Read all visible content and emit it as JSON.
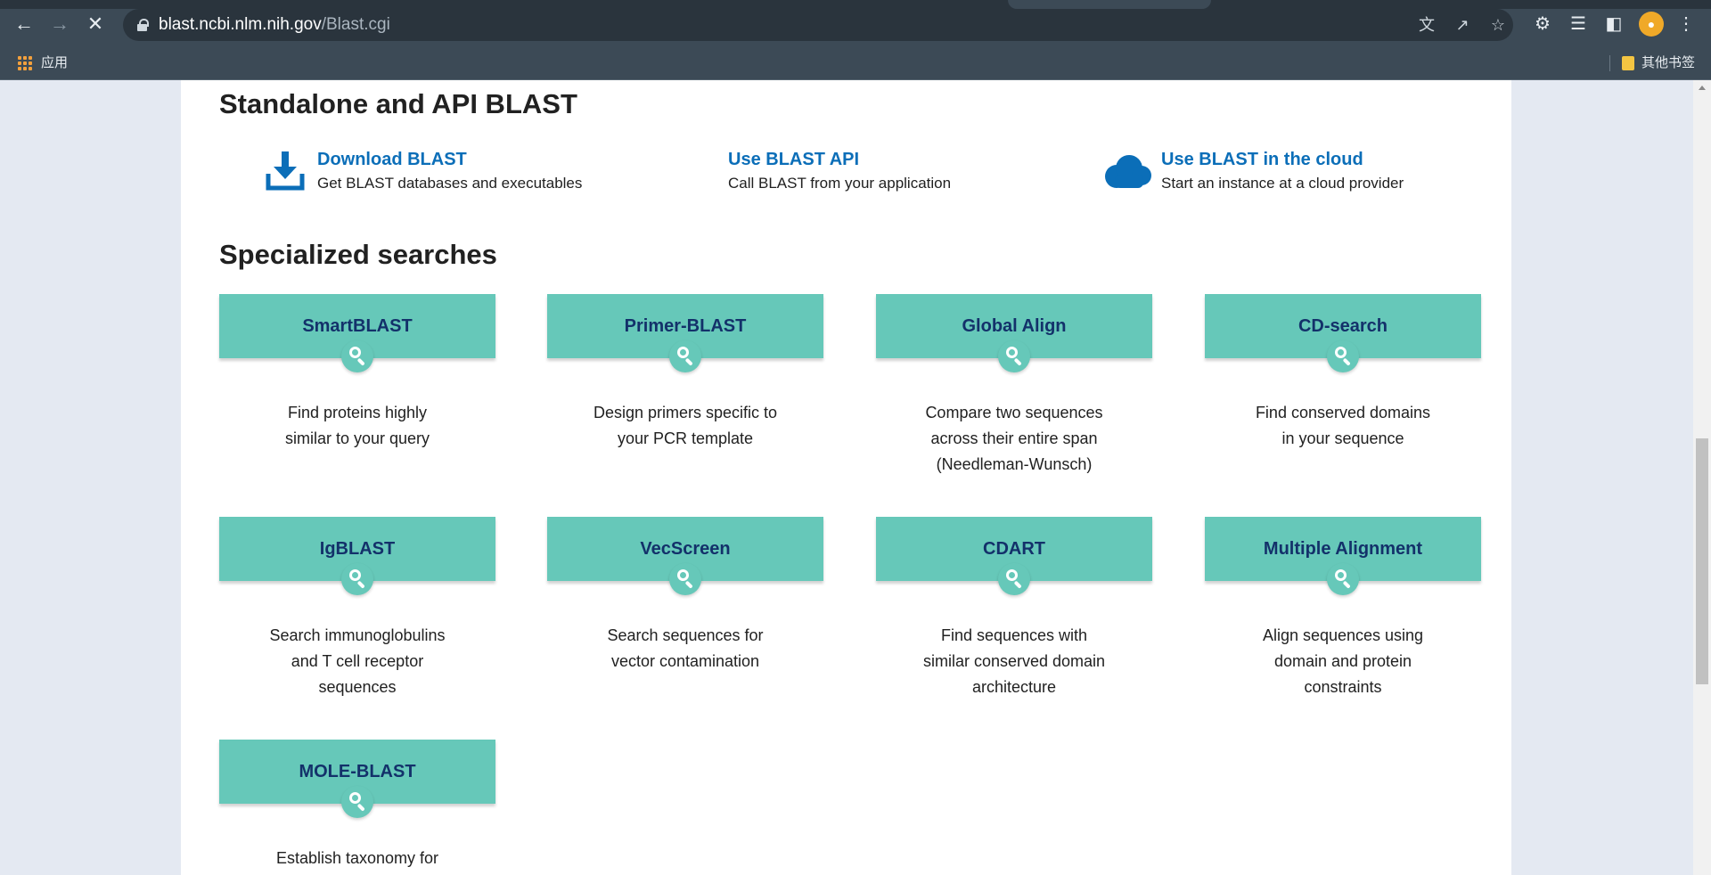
{
  "browser": {
    "url_host": "blast.ncbi.nlm.nih.gov",
    "url_path": "/Blast.cgi",
    "apps_label": "应用",
    "other_bookmarks": "其他书签"
  },
  "standalone": {
    "heading": "Standalone and API BLAST",
    "items": [
      {
        "title": "Download BLAST",
        "desc": "Get BLAST databases and executables",
        "icon": "download-icon"
      },
      {
        "title": "Use BLAST API",
        "desc": "Call BLAST from your application",
        "icon": ""
      },
      {
        "title": "Use BLAST in the cloud",
        "desc": "Start an instance at a cloud provider",
        "icon": "cloud-icon"
      }
    ]
  },
  "specialized": {
    "heading": "Specialized searches",
    "cards": [
      {
        "title": "SmartBLAST",
        "lines": [
          "Find proteins highly",
          "similar to your query"
        ]
      },
      {
        "title": "Primer-BLAST",
        "lines": [
          "Design primers specific to",
          "your PCR template"
        ]
      },
      {
        "title": "Global Align",
        "lines": [
          "Compare two sequences",
          "across their entire span",
          "(Needleman-Wunsch)"
        ]
      },
      {
        "title": "CD-search",
        "lines": [
          "Find conserved domains",
          "in your sequence"
        ]
      },
      {
        "title": "IgBLAST",
        "lines": [
          "Search immunoglobulins",
          "and T cell receptor",
          "sequences"
        ]
      },
      {
        "title": "VecScreen",
        "lines": [
          "Search sequences for",
          "vector contamination"
        ]
      },
      {
        "title": "CDART",
        "lines": [
          "Find sequences with",
          "similar conserved domain",
          "architecture"
        ]
      },
      {
        "title": "Multiple Alignment",
        "lines": [
          "Align sequences using",
          "domain and protein",
          "constraints"
        ]
      },
      {
        "title": "MOLE-BLAST",
        "lines": [
          "Establish taxonomy for"
        ]
      }
    ]
  },
  "colors": {
    "card_bg": "#66c8b9",
    "card_title": "#13316a",
    "link_blue": "#0b6eb8"
  }
}
